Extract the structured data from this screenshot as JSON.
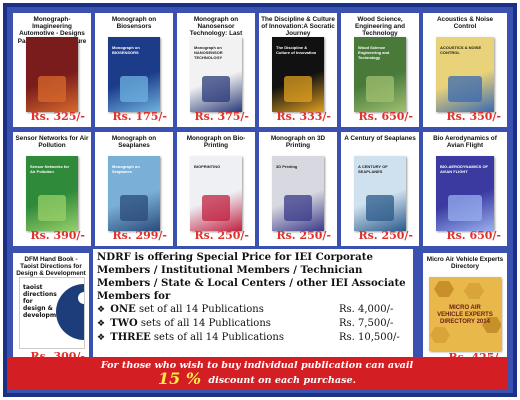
{
  "books": [
    {
      "title": "Monograph-Imagineering Automotive - Designs Past, Present & Future",
      "price": "Rs. 325/-",
      "cover_bg": "#7a1c1c",
      "cover_accent": "#d86a2c",
      "cover_text": ""
    },
    {
      "title": "Monograph on Biosensors",
      "price": "Rs. 175/-",
      "cover_bg": "#1c3c8a",
      "cover_accent": "#6fb3e0",
      "cover_text": "Monograph on BIOSENSORS"
    },
    {
      "title": "Monograph on Nanosensor Technology: Last Technological Revolution?",
      "price": "Rs. 375/-",
      "cover_bg": "#f2f2f2",
      "cover_accent": "#2a3a7a",
      "cover_text": "Monograph on NANOSENSOR TECHNOLOGY"
    },
    {
      "title": "The Discipline & Culture of Innovation:A Socratic Journey",
      "price": "Rs. 333/-",
      "cover_bg": "#111111",
      "cover_accent": "#e0a020",
      "cover_text": "The Discipline & Culture of Innovation"
    },
    {
      "title": "Wood Science, Engineering and Technology",
      "price": "Rs. 650/-",
      "cover_bg": "#4a7a3a",
      "cover_accent": "#a0c070",
      "cover_text": "Wood Science Engineering and Technology"
    },
    {
      "title": "Acoustics & Noise Control",
      "price": "Rs. 350/-",
      "cover_bg": "#e8d27a",
      "cover_accent": "#3a6ab0",
      "cover_text": "ACOUSTICS & NOISE CONTROL"
    },
    {
      "title": "Sensor Networks for Air Pollution",
      "price": "Rs. 390/-",
      "cover_bg": "#2f8a3a",
      "cover_accent": "#9ad06a",
      "cover_text": "Sensor Networks for Air Pollution"
    },
    {
      "title": "Monograph on Seaplanes",
      "price": "Rs. 299/-",
      "cover_bg": "#7ab0d8",
      "cover_accent": "#2a4a7a",
      "cover_text": "Monograph on Seaplanes"
    },
    {
      "title": "Monograph on Bio-Printing",
      "price": "Rs. 250/-",
      "cover_bg": "#eef0f4",
      "cover_accent": "#c02040",
      "cover_text": "BIOPRINTING"
    },
    {
      "title": "Monograph on 3D Printing",
      "price": "Rs. 250/-",
      "cover_bg": "#d8d8e0",
      "cover_accent": "#3a3a8a",
      "cover_text": "3D Printing"
    },
    {
      "title": "A Century of Seaplanes",
      "price": "Rs. 250/-",
      "cover_bg": "#cfe0ee",
      "cover_accent": "#2a5a8a",
      "cover_text": "A CENTURY OF SEAPLANES"
    },
    {
      "title": "Bio Aerodynamics of Avian Flight",
      "price": "Rs. 650/-",
      "cover_bg": "#3a3aa0",
      "cover_accent": "#9ab0f0",
      "cover_text": "BIO-AERODYNAMICS OF AVIAN FLIGHT"
    }
  ],
  "dfm": {
    "title": "DFM Hand Book - Taoist Directions for Design & Development",
    "price": "Rs. 300/-",
    "cover_text": "taoist directions for design & development"
  },
  "uav": {
    "title": "Micro Air Vehicle Experts Directory",
    "price": "Rs. 425/-",
    "cover_text": "MICRO AIR VEHICLE EXPERTS DIRECTORY 2014"
  },
  "offer": {
    "headline": "NDRF is offering Special Price for IEI Corporate Members / Institutional Members / Technician Members / State & Local Centers / other IEI Associate Members for",
    "rows": [
      {
        "bullet": "❖",
        "qty": "ONE",
        "text": "set of all 14 Publications",
        "amount": "Rs.  4,000/-"
      },
      {
        "bullet": "❖",
        "qty": "TWO",
        "text": "sets of all 14 Publications",
        "amount": "Rs.  7,500/-"
      },
      {
        "bullet": "❖",
        "qty": "THREE",
        "text": "sets of all 14 Publications",
        "amount": "Rs. 10,500/-"
      }
    ]
  },
  "banner": {
    "line1": "For those who wish to buy individual publication can avail",
    "percent": "15 %",
    "line2": "discount on each purchase."
  },
  "colors": {
    "price": "#e0312b",
    "frame": "#1a2f86",
    "panel": "#3b51b0",
    "banner": "#d31f24",
    "highlight": "#ffe94a"
  }
}
